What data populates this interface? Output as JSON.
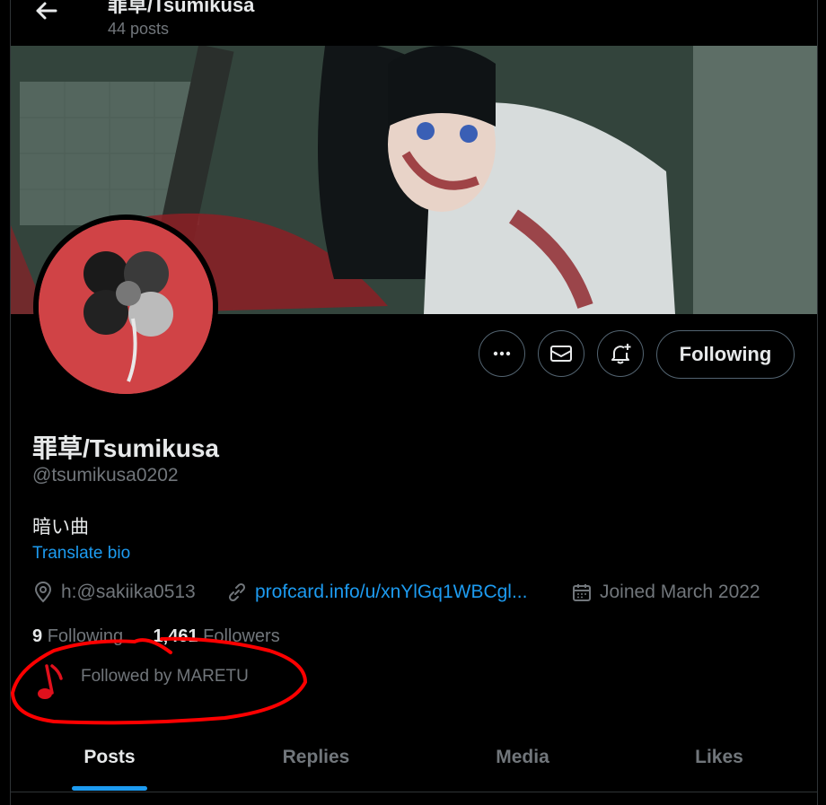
{
  "header": {
    "title": "罪草/Tsumikusa",
    "post_count": "44 posts"
  },
  "profile": {
    "display_name": "罪草/Tsumikusa",
    "handle": "@tsumikusa0202",
    "bio": "暗い曲",
    "translate_label": "Translate bio",
    "location": "h:@sakiika0513",
    "website": "profcard.info/u/xnYlGq1WBCgl...",
    "joined": "Joined March 2022",
    "following_count": "9",
    "following_label": "Following",
    "followers_count": "1,461",
    "followers_label": "Followers",
    "followed_by": "Followed by MARETU"
  },
  "actions": {
    "more_icon": "more-horizontal-icon",
    "message_icon": "mail-icon",
    "notify_icon": "bell-plus-icon",
    "follow_label": "Following"
  },
  "tabs": [
    {
      "label": "Posts",
      "active": true
    },
    {
      "label": "Replies",
      "active": false
    },
    {
      "label": "Media",
      "active": false
    },
    {
      "label": "Likes",
      "active": false
    }
  ],
  "colors": {
    "accent": "#1d9bf0",
    "annotation": "#ff0000",
    "avatar_bg": "#d04346"
  }
}
